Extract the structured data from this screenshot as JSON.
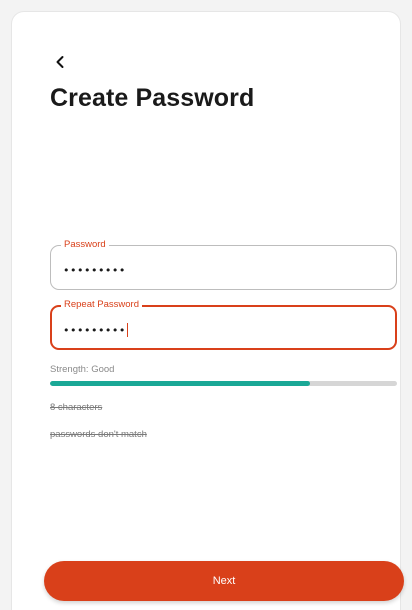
{
  "page": {
    "title": "Create Password"
  },
  "form": {
    "password": {
      "label": "Password",
      "value": "•••••••••"
    },
    "repeat_password": {
      "label": "Repeat Password",
      "value": "•••••••••"
    }
  },
  "strength": {
    "label": "Strength: Good",
    "fill_fraction": 0.75
  },
  "rules": [
    {
      "text": "8 characters"
    },
    {
      "text": "passwords don't match"
    }
  ],
  "actions": {
    "next_label": "Next"
  },
  "colors": {
    "accent": "#d9401a",
    "strength_fill": "#1aa896",
    "strength_track": "#d6d6d6"
  },
  "icons": {
    "back": "chevron-left-icon"
  }
}
